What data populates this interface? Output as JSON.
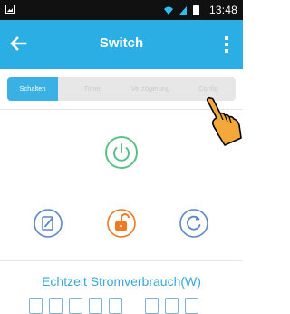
{
  "status_bar": {
    "time": "13:48",
    "icons": [
      "image-icon",
      "wifi-icon",
      "signal-icon",
      "battery-icon"
    ]
  },
  "app_bar": {
    "title": "Switch",
    "back_icon": "back-arrow-icon",
    "menu_icon": "overflow-menu-icon"
  },
  "tabs": [
    {
      "label": "Schalten",
      "active": true
    },
    {
      "label": "Timer",
      "active": false
    },
    {
      "label": "Verzögerung",
      "active": false
    },
    {
      "label": "Config",
      "active": false
    }
  ],
  "controls": {
    "power_icon": "power-icon",
    "actions": [
      "edit-icon",
      "unlock-icon",
      "refresh-icon"
    ]
  },
  "power_consumption": {
    "label": "Echtzeit Stromverbrauch(W)"
  },
  "colors": {
    "primary": "#2aaee3",
    "power_green": "#5cc08b",
    "unlock_orange": "#f07a22",
    "action_blue": "#5b87c8"
  }
}
